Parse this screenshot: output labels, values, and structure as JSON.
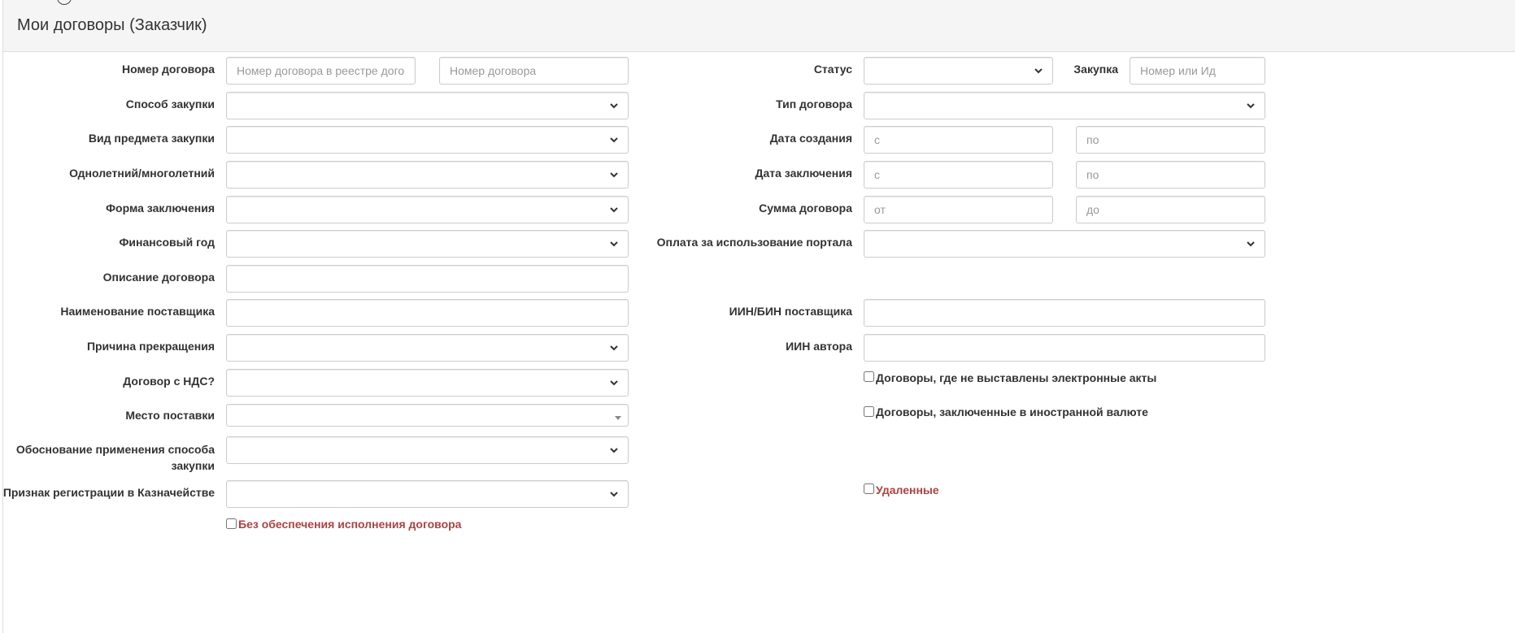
{
  "header": {
    "title": "Мои договоры (Заказчик)"
  },
  "left": {
    "contract_number_label": "Номер договора",
    "contract_registry_placeholder": "Номер договора в реестре договоров",
    "contract_number_placeholder": "Номер договора",
    "purchase_method_label": "Способ закупки",
    "subject_type_label": "Вид предмета закупки",
    "term_label": "Однолетний/многолетний",
    "conclusion_form_label": "Форма заключения",
    "financial_year_label": "Финансовый год",
    "description_label": "Описание договора",
    "supplier_name_label": "Наименование поставщика",
    "termination_reason_label": "Причина прекращения",
    "vat_label": "Договор с НДС?",
    "delivery_place_label": "Место поставки",
    "justification_label_line1": "Обоснование применения способа",
    "justification_label_line2": "закупки",
    "treasury_label": "Признак регистрации в Казначействе",
    "no_security_checkbox": "Без обеспечения исполнения договора"
  },
  "right": {
    "status_label": "Статус",
    "purchase_label": "Закупка",
    "purchase_placeholder": "Номер или Ид",
    "contract_type_label": "Тип договора",
    "created_date_label": "Дата создания",
    "concluded_date_label": "Дата заключения",
    "amount_label": "Сумма договора",
    "from_placeholder": "с",
    "to_placeholder": "по",
    "amount_from_placeholder": "от",
    "amount_to_placeholder": "до",
    "portal_fee_label": "Оплата за использование портала",
    "supplier_iin_label": "ИИН/БИН поставщика",
    "author_iin_label": "ИИН автора",
    "no_acts_checkbox": "Договоры, где не выставлены электронные акты",
    "foreign_currency_checkbox": "Договоры, заключенные в иностранной валюте",
    "deleted_checkbox": "Удаленные"
  },
  "icons": {
    "select_arrow": "chevron-down-icon",
    "dropdown_caret": "caret-down-icon"
  },
  "colors": {
    "danger_text": "#a94442",
    "border": "#cccccc",
    "heading_bg": "#f5f5f5"
  }
}
